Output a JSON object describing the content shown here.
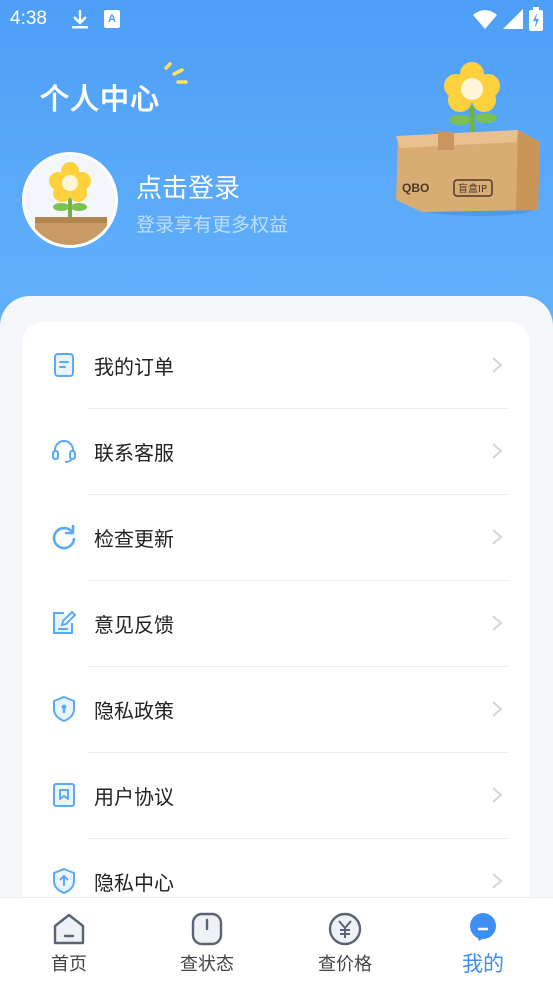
{
  "status": {
    "time": "4:38"
  },
  "header": {
    "title": "个人中心",
    "login_title": "点击登录",
    "login_sub": "登录享有更多权益",
    "box_brand": "QBO",
    "box_tag": "盲盒IP"
  },
  "menu": [
    {
      "label": "我的订单",
      "icon": "order-icon"
    },
    {
      "label": "联系客服",
      "icon": "headset-icon"
    },
    {
      "label": "检查更新",
      "icon": "refresh-icon"
    },
    {
      "label": "意见反馈",
      "icon": "feedback-icon"
    },
    {
      "label": "隐私政策",
      "icon": "shield-icon"
    },
    {
      "label": "用户协议",
      "icon": "bookmark-icon"
    },
    {
      "label": "隐私中心",
      "icon": "shield-icon"
    }
  ],
  "tabs": [
    {
      "label": "首页",
      "icon": "home-icon"
    },
    {
      "label": "查状态",
      "icon": "power-icon"
    },
    {
      "label": "查价格",
      "icon": "yen-icon"
    },
    {
      "label": "我的",
      "icon": "profile-icon",
      "active": true
    }
  ],
  "colors": {
    "accent": "#3d8ff5",
    "header": "#4d9ef6",
    "icon": "#5aaaf5"
  }
}
